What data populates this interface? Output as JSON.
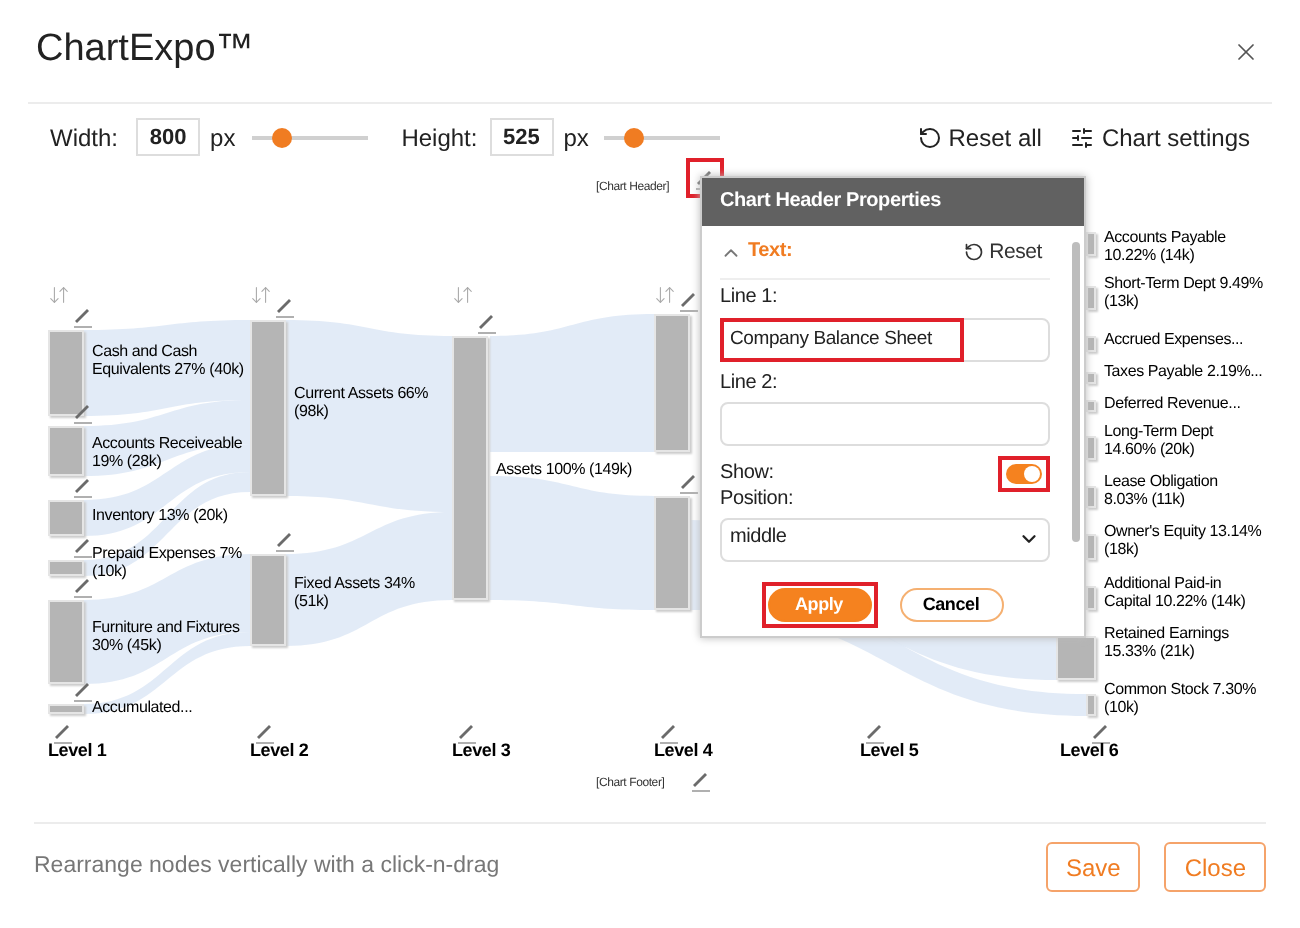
{
  "app": {
    "title": "ChartExpo™"
  },
  "toolbar": {
    "width": {
      "label": "Width:",
      "value": "800",
      "unit": "px",
      "level": 0.27
    },
    "height": {
      "label": "Height:",
      "value": "525",
      "unit": "px",
      "level": 0.25
    },
    "reset_all": "Reset all",
    "chart_settings": "Chart settings"
  },
  "chart": {
    "header_placeholder": "[Chart Header]",
    "footer_placeholder": "[Chart Footer]",
    "levels": [
      {
        "label": "Level 1",
        "nodes": [
          {
            "label": "Cash and Cash Equivalents 27% (40k)"
          },
          {
            "label": "Accounts Receiveable 19% (28k)"
          },
          {
            "label": "Inventory 13% (20k)"
          },
          {
            "label": "Prepaid Expenses 7% (10k)"
          },
          {
            "label": "Furniture and Fixtures 30% (45k)"
          },
          {
            "label": "Accumulated..."
          }
        ]
      },
      {
        "label": "Level 2",
        "nodes": [
          {
            "label": "Current Assets 66% (98k)"
          },
          {
            "label": "Fixed Assets 34% (51k)"
          }
        ]
      },
      {
        "label": "Level 3",
        "nodes": [
          {
            "label": "Assets 100% (149k)"
          }
        ]
      },
      {
        "label": "Level 4"
      },
      {
        "label": "Level 5"
      },
      {
        "label": "Level 6",
        "nodes": [
          {
            "label": "Accounts Payable 10.22% (14k)"
          },
          {
            "label": "Short-Term Dept 9.49% (13k)"
          },
          {
            "label": "Accrued Expenses..."
          },
          {
            "label": "Taxes Payable 2.19%..."
          },
          {
            "label": "Deferred Revenue..."
          },
          {
            "label": "Long-Term Dept 14.60% (20k)"
          },
          {
            "label": "Lease Obligation 8.03% (11k)"
          },
          {
            "label": "Owner's Equity 13.14% (18k)"
          },
          {
            "label": "Additional Paid-in Capital 10.22% (14k)"
          },
          {
            "label": "Retained Earnings 15.33% (21k)"
          },
          {
            "label": "Common Stock 7.30% (10k)"
          }
        ]
      }
    ]
  },
  "properties_panel": {
    "title": "Chart Header Properties",
    "section": {
      "label": "Text:",
      "expanded": true
    },
    "reset": "Reset",
    "line_1": {
      "label": "Line 1:",
      "value": "Company Balance Sheet"
    },
    "line_2": {
      "label": "Line 2:"
    },
    "show": {
      "label": "Show:",
      "on": true
    },
    "position": {
      "label": "Position:",
      "value": "middle"
    },
    "buttons": [
      "Apply",
      "Cancel"
    ]
  },
  "footer": {
    "hint": "Rearrange nodes vertically with a click-n-drag",
    "buttons": [
      "Save",
      "Close"
    ]
  }
}
